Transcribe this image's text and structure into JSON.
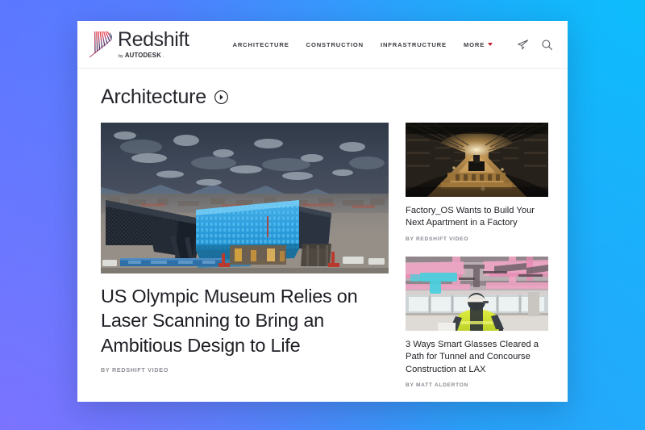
{
  "background": {
    "gradient_top_left": "#5878ff",
    "gradient_top_right": "#0dbdfc",
    "gradient_bottom_left": "#7b73ff",
    "gradient_bottom_right": "#25a8fb"
  },
  "header": {
    "brand": {
      "name": "Redshift",
      "by": "by",
      "parent": "AUTODESK",
      "parent_suffix": "."
    },
    "nav": [
      {
        "label": "ARCHITECTURE"
      },
      {
        "label": "CONSTRUCTION"
      },
      {
        "label": "INFRASTRUCTURE"
      }
    ],
    "more": {
      "label": "MORE",
      "chevron_color": "#c8202f"
    },
    "actions": [
      {
        "name": "subscribe-icon"
      },
      {
        "name": "search-icon"
      }
    ]
  },
  "section": {
    "title": "Architecture",
    "arrow_icon": "circle-arrow-right-icon"
  },
  "featured": {
    "title": "US Olympic Museum Relies on Laser Scanning to Bring an Ambitious Design to Life",
    "byline": "BY REDSHIFT VIDEO",
    "image_alt": "US Olympic Museum under construction with blue clad volume against snowy mountains"
  },
  "side_articles": [
    {
      "title": "Factory_OS Wants to Build Your Next Apartment in a Factory",
      "byline": "BY REDSHIFT VIDEO",
      "image_alt": "Dark factory interior with warm golden light along a long assembly hall"
    },
    {
      "title": "3 Ways Smart Glasses Cleared a Path for Tunnel and Concourse Construction at LAX",
      "byline": "BY MATT ALDERTON",
      "image_alt": "Construction worker in yellow hi-vis vest viewing pink and cyan augmented overlay on ceiling"
    }
  ],
  "colors": {
    "accent_red": "#c8202f",
    "text_dark": "#1f1f26",
    "text_muted": "#8b8b94",
    "card_background": "#ffffff"
  }
}
